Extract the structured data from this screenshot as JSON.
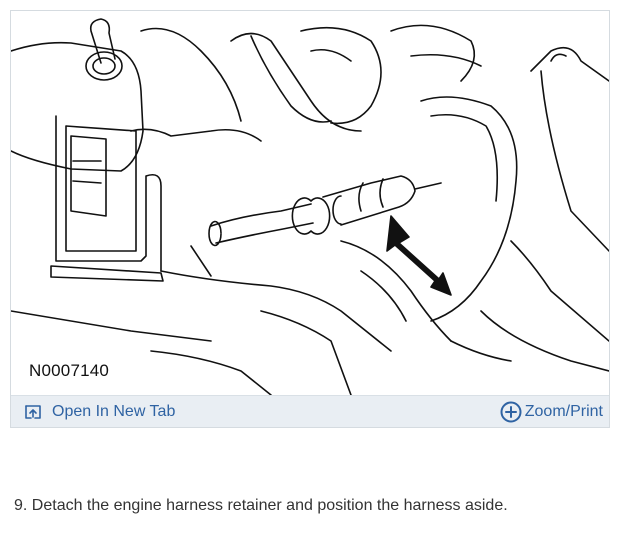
{
  "figure": {
    "code": "N0007140",
    "illustration_icon": "engine-harness-retainer-line-drawing"
  },
  "toolbar": {
    "open_tab_label": "Open In New Tab",
    "open_tab_icon": "open-in-new-tab-icon",
    "zoom_label": "Zoom/Print",
    "zoom_icon": "plus-circle-icon"
  },
  "step": {
    "text": "9. Detach the engine harness retainer and position the harness aside."
  },
  "colors": {
    "link": "#2f63a3",
    "toolbar_bg": "#e9eef3",
    "line_art": "#111111"
  }
}
